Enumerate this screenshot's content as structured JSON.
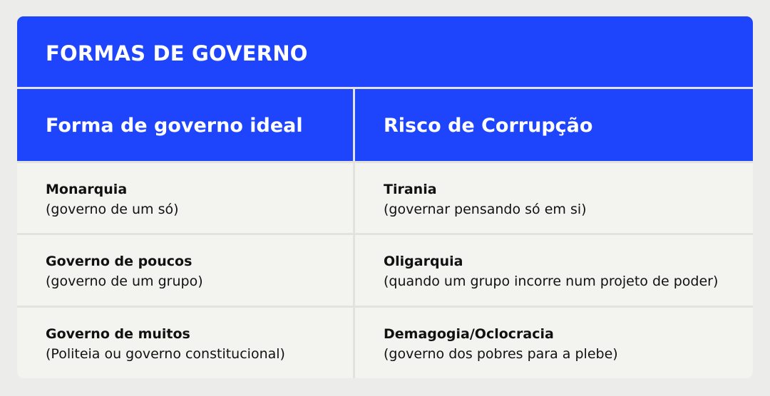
{
  "title": "FORMAS DE GOVERNO",
  "columns": {
    "left": "Forma de governo ideal",
    "right": "Risco de Corrupção"
  },
  "rows": [
    {
      "ideal": {
        "title": "Monarquia",
        "desc": "(governo de um só)"
      },
      "risk": {
        "title": "Tirania",
        "desc": "(governar pensando só em si)"
      }
    },
    {
      "ideal": {
        "title": "Governo de poucos",
        "desc": "(governo de um grupo)"
      },
      "risk": {
        "title": "Oligarquia",
        "desc": "(quando um grupo incorre num projeto de poder)"
      }
    },
    {
      "ideal": {
        "title": "Governo de muitos",
        "desc": "(Politeia ou governo constitucional)"
      },
      "risk": {
        "title": "Demagogia/Oclocracia",
        "desc": "(governo dos pobres para a plebe)"
      }
    }
  ],
  "colors": {
    "header": "#1f45fc",
    "cell": "#f3f3ef",
    "text": "#111111"
  }
}
